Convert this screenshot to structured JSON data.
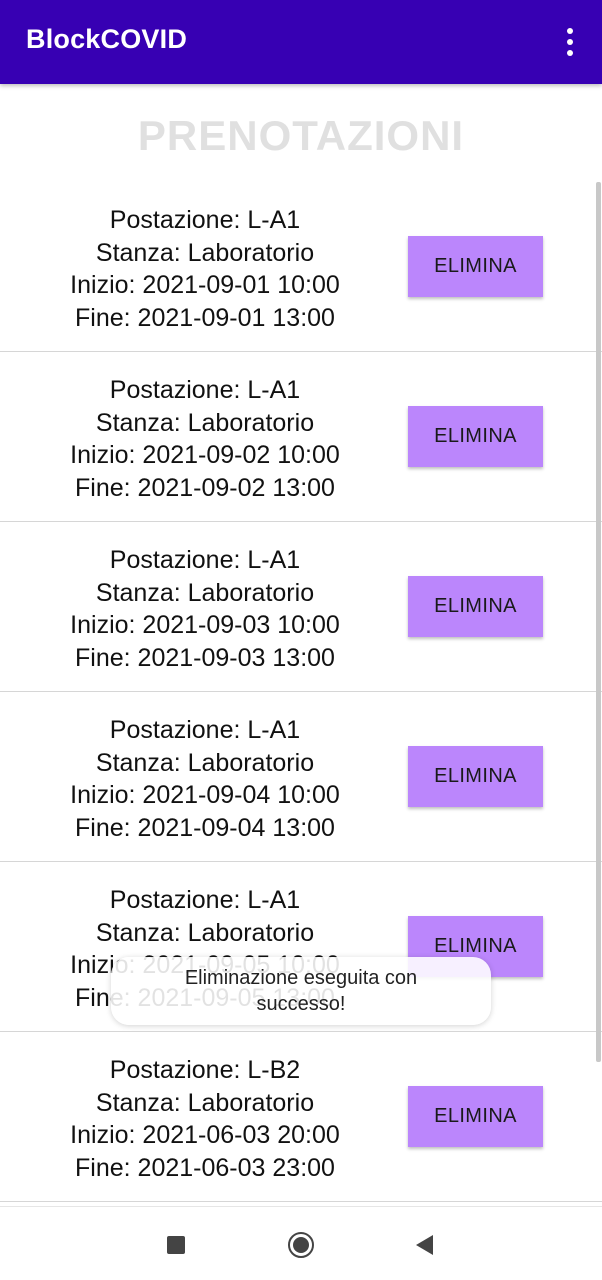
{
  "app": {
    "title": "BlockCOVID",
    "overflow_icon": "more-vert-icon"
  },
  "page": {
    "title": "PRENOTAZIONI"
  },
  "bookings": [
    {
      "workstation": "Postazione: L-A1",
      "room": "Stanza: Laboratorio",
      "start": "Inizio: 2021-09-01 10:00",
      "end": "Fine: 2021-09-01 13:00",
      "button_label": "ELIMINA"
    },
    {
      "workstation": "Postazione: L-A1",
      "room": "Stanza: Laboratorio",
      "start": "Inizio: 2021-09-02 10:00",
      "end": "Fine: 2021-09-02 13:00",
      "button_label": "ELIMINA"
    },
    {
      "workstation": "Postazione: L-A1",
      "room": "Stanza: Laboratorio",
      "start": "Inizio: 2021-09-03 10:00",
      "end": "Fine: 2021-09-03 13:00",
      "button_label": "ELIMINA"
    },
    {
      "workstation": "Postazione: L-A1",
      "room": "Stanza: Laboratorio",
      "start": "Inizio: 2021-09-04 10:00",
      "end": "Fine: 2021-09-04 13:00",
      "button_label": "ELIMINA"
    },
    {
      "workstation": "Postazione: L-A1",
      "room": "Stanza: Laboratorio",
      "start": "Inizio: 2021-09-05 10:00",
      "end": "Fine: 2021-09-05 13:00",
      "button_label": "ELIMINA"
    },
    {
      "workstation": "Postazione: L-B2",
      "room": "Stanza: Laboratorio",
      "start": "Inizio: 2021-06-03 20:00",
      "end": "Fine: 2021-06-03 23:00",
      "button_label": "ELIMINA"
    }
  ],
  "toast": {
    "message": "Eliminazione eseguita con successo!"
  },
  "navbar": {
    "recents_icon": "recents-square-icon",
    "home_icon": "home-circle-icon",
    "back_icon": "back-triangle-icon"
  },
  "colors": {
    "appbar": "#3700b3",
    "button": "#bb86fc",
    "title_text": "#e0e0e0"
  }
}
